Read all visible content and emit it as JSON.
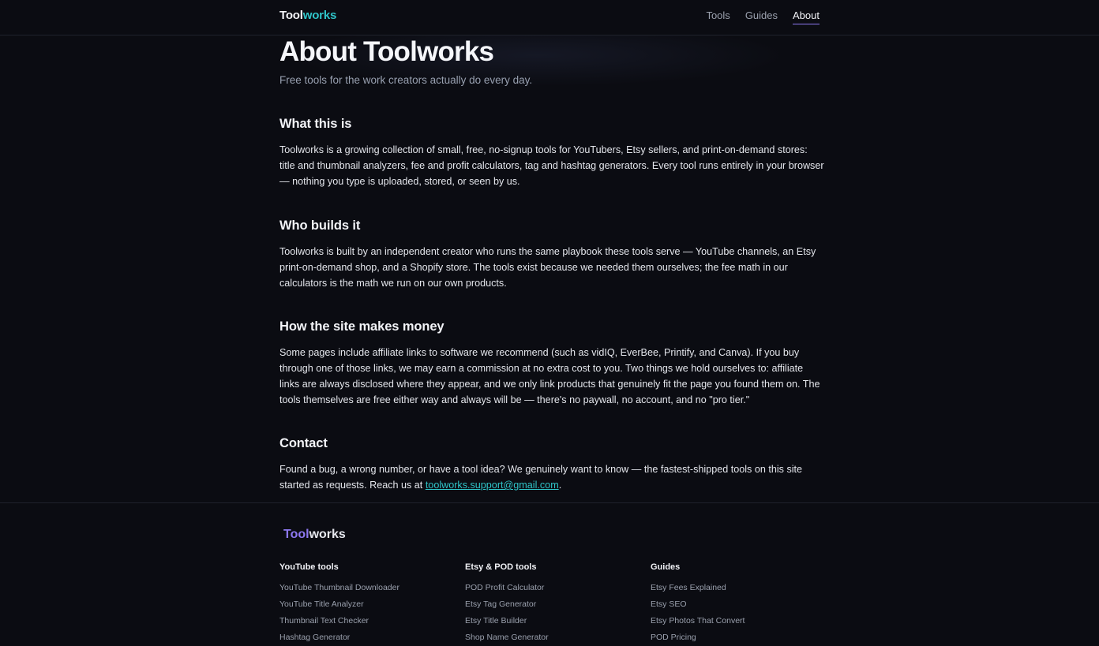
{
  "header": {
    "logo_part1": "Tool",
    "logo_part2": "works",
    "nav": [
      "Tools",
      "Guides",
      "About"
    ]
  },
  "page": {
    "title": "About Toolworks",
    "subtitle": "Free tools for the work creators actually do every day."
  },
  "sections": [
    {
      "heading": "What this is",
      "body": "Toolworks is a growing collection of small, free, no-signup tools for YouTubers, Etsy sellers, and print-on-demand stores: title and thumbnail analyzers, fee and profit calculators, tag and hashtag generators. Every tool runs entirely in your browser — nothing you type is uploaded, stored, or seen by us."
    },
    {
      "heading": "Who builds it",
      "body": "Toolworks is built by an independent creator who runs the same playbook these tools serve — YouTube channels, an Etsy print-on-demand shop, and a Shopify store. The tools exist because we needed them ourselves; the fee math in our calculators is the math we run on our own products."
    },
    {
      "heading": "How the site makes money",
      "body": "Some pages include affiliate links to software we recommend (such as vidIQ, EverBee, Printify, and Canva). If you buy through one of those links, we may earn a commission at no extra cost to you. Two things we hold ourselves to: affiliate links are always disclosed where they appear, and we only link products that genuinely fit the page you found them on. The tools themselves are free either way and always will be — there's no paywall, no account, and no \"pro tier.\""
    },
    {
      "heading": "Contact",
      "body_before": "Found a bug, a wrong number, or have a tool idea? We genuinely want to know — the fastest-shipped tools on this site started as requests. Reach us at ",
      "email": "toolworks.support@gmail.com",
      "body_after": "."
    }
  ],
  "footer": {
    "logo_part1": "Tool",
    "logo_part2": "works",
    "columns": [
      {
        "heading": "YouTube tools",
        "links": [
          "YouTube Thumbnail Downloader",
          "YouTube Title Analyzer",
          "Thumbnail Text Checker",
          "Hashtag Generator"
        ]
      },
      {
        "heading": "Etsy & POD tools",
        "links": [
          "POD Profit Calculator",
          "Etsy Tag Generator",
          "Etsy Title Builder",
          "Shop Name Generator"
        ]
      },
      {
        "heading": "Guides",
        "links": [
          "Etsy Fees Explained",
          "Etsy SEO",
          "Etsy Photos That Convert",
          "POD Pricing"
        ]
      }
    ]
  },
  "colors": {
    "background": "#0b0c12",
    "accent_teal": "#2fc4c8",
    "accent_purple": "#8d78f0"
  }
}
